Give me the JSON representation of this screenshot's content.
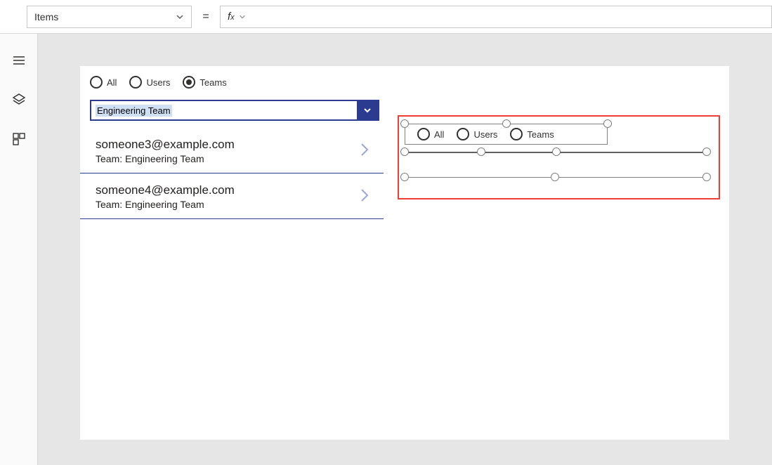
{
  "formula_bar": {
    "property": "Items",
    "fx_label": "fx",
    "value": ""
  },
  "left_radios": {
    "options": [
      "All",
      "Users",
      "Teams"
    ],
    "selected_index": 2
  },
  "dropdown": {
    "text": "Engineering Team"
  },
  "list_items": [
    {
      "primary": "someone3@example.com",
      "secondary": "Team: Engineering Team"
    },
    {
      "primary": "someone4@example.com",
      "secondary": "Team: Engineering Team"
    }
  ],
  "right_radios": {
    "options": [
      "All",
      "Users",
      "Teams"
    ]
  }
}
